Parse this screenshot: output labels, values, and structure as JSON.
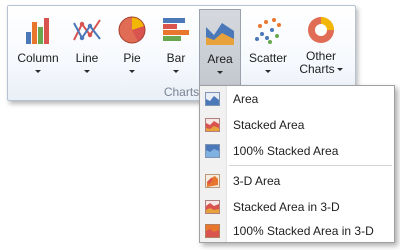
{
  "ribbon": {
    "group_caption": "Charts",
    "buttons": [
      {
        "label": "Column",
        "icon": "column-chart-icon"
      },
      {
        "label": "Line",
        "icon": "line-chart-icon"
      },
      {
        "label": "Pie",
        "icon": "pie-chart-icon"
      },
      {
        "label": "Bar",
        "icon": "bar-chart-icon"
      },
      {
        "label": "Area",
        "icon": "area-chart-icon",
        "active": true
      },
      {
        "label": "Scatter",
        "icon": "scatter-chart-icon"
      },
      {
        "label_line1": "Other",
        "label_line2": "Charts",
        "icon": "other-charts-icon"
      }
    ]
  },
  "area_menu": {
    "items": [
      {
        "label": "Area",
        "icon": "area-icon"
      },
      {
        "label": "Stacked Area",
        "icon": "stacked-area-icon"
      },
      {
        "label": "100% Stacked Area",
        "icon": "full-stacked-area-icon"
      },
      {
        "label": "3-D Area",
        "icon": "area-3d-icon"
      },
      {
        "label": "Stacked Area in 3-D",
        "icon": "stacked-area-3d-icon"
      },
      {
        "label": "100% Stacked Area in 3-D",
        "icon": "full-stacked-area-3d-icon"
      }
    ]
  },
  "colors": {
    "orange": "#e8762d",
    "blue": "#4a78b8",
    "red": "#d9534f",
    "green": "#6aa84f",
    "group_border": "#b7c3d3"
  }
}
